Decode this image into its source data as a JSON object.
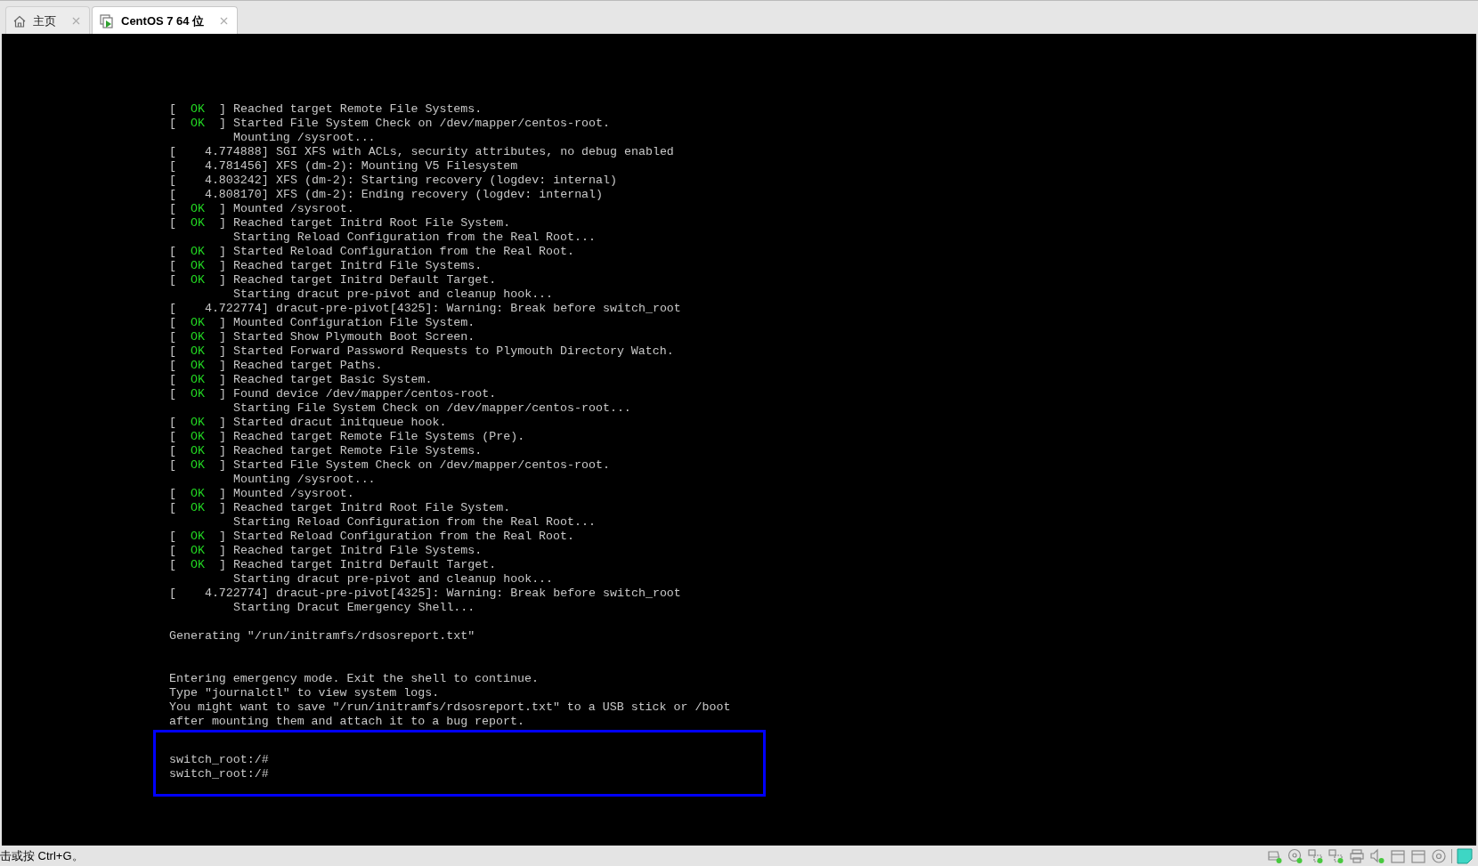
{
  "tabs": [
    {
      "kind": "home",
      "label": "主页",
      "selected": false
    },
    {
      "kind": "vm",
      "label": "CentOS 7 64 位",
      "selected": true
    }
  ],
  "console": {
    "lines": [
      {
        "kind": "ok",
        "open": "[",
        "status": "OK",
        "close": "]",
        "text": "Reached target Remote File Systems."
      },
      {
        "kind": "ok",
        "open": "[",
        "status": "OK",
        "close": "]",
        "text": "Started File System Check on /dev/mapper/centos-root."
      },
      {
        "kind": "job",
        "text": "Mounting /sysroot..."
      },
      {
        "kind": "kernel",
        "time": "[    4.774888]",
        "text": "SGI XFS with ACLs, security attributes, no debug enabled"
      },
      {
        "kind": "kernel",
        "time": "[    4.781456]",
        "text": "XFS (dm-2): Mounting V5 Filesystem"
      },
      {
        "kind": "kernel",
        "time": "[    4.803242]",
        "text": "XFS (dm-2): Starting recovery (logdev: internal)"
      },
      {
        "kind": "kernel",
        "time": "[    4.808170]",
        "text": "XFS (dm-2): Ending recovery (logdev: internal)"
      },
      {
        "kind": "ok",
        "open": "[",
        "status": "OK",
        "close": "]",
        "text": "Mounted /sysroot."
      },
      {
        "kind": "ok",
        "open": "[",
        "status": "OK",
        "close": "]",
        "text": "Reached target Initrd Root File System."
      },
      {
        "kind": "job",
        "text": "Starting Reload Configuration from the Real Root..."
      },
      {
        "kind": "ok",
        "open": "[",
        "status": "OK",
        "close": "]",
        "text": "Started Reload Configuration from the Real Root."
      },
      {
        "kind": "ok",
        "open": "[",
        "status": "OK",
        "close": "]",
        "text": "Reached target Initrd File Systems."
      },
      {
        "kind": "ok",
        "open": "[",
        "status": "OK",
        "close": "]",
        "text": "Reached target Initrd Default Target."
      },
      {
        "kind": "job",
        "text": "Starting dracut pre-pivot and cleanup hook..."
      },
      {
        "kind": "kernel",
        "time": "[    4.722774]",
        "text": "dracut-pre-pivot[4325]: Warning: Break before switch_root"
      },
      {
        "kind": "ok",
        "open": "[",
        "status": "OK",
        "close": "]",
        "text": "Mounted Configuration File System."
      },
      {
        "kind": "ok",
        "open": "[",
        "status": "OK",
        "close": "]",
        "text": "Started Show Plymouth Boot Screen."
      },
      {
        "kind": "ok",
        "open": "[",
        "status": "OK",
        "close": "]",
        "text": "Started Forward Password Requests to Plymouth Directory Watch."
      },
      {
        "kind": "ok",
        "open": "[",
        "status": "OK",
        "close": "]",
        "text": "Reached target Paths."
      },
      {
        "kind": "ok",
        "open": "[",
        "status": "OK",
        "close": "]",
        "text": "Reached target Basic System."
      },
      {
        "kind": "ok",
        "open": "[",
        "status": "OK",
        "close": "]",
        "text": "Found device /dev/mapper/centos-root."
      },
      {
        "kind": "job",
        "text": "Starting File System Check on /dev/mapper/centos-root..."
      },
      {
        "kind": "ok",
        "open": "[",
        "status": "OK",
        "close": "]",
        "text": "Started dracut initqueue hook."
      },
      {
        "kind": "ok",
        "open": "[",
        "status": "OK",
        "close": "]",
        "text": "Reached target Remote File Systems (Pre)."
      },
      {
        "kind": "ok",
        "open": "[",
        "status": "OK",
        "close": "]",
        "text": "Reached target Remote File Systems."
      },
      {
        "kind": "ok",
        "open": "[",
        "status": "OK",
        "close": "]",
        "text": "Started File System Check on /dev/mapper/centos-root."
      },
      {
        "kind": "job",
        "text": "Mounting /sysroot..."
      },
      {
        "kind": "ok",
        "open": "[",
        "status": "OK",
        "close": "]",
        "text": "Mounted /sysroot."
      },
      {
        "kind": "ok",
        "open": "[",
        "status": "OK",
        "close": "]",
        "text": "Reached target Initrd Root File System."
      },
      {
        "kind": "job",
        "text": "Starting Reload Configuration from the Real Root..."
      },
      {
        "kind": "ok",
        "open": "[",
        "status": "OK",
        "close": "]",
        "text": "Started Reload Configuration from the Real Root."
      },
      {
        "kind": "ok",
        "open": "[",
        "status": "OK",
        "close": "]",
        "text": "Reached target Initrd File Systems."
      },
      {
        "kind": "ok",
        "open": "[",
        "status": "OK",
        "close": "]",
        "text": "Reached target Initrd Default Target."
      },
      {
        "kind": "job",
        "text": "Starting dracut pre-pivot and cleanup hook..."
      },
      {
        "kind": "kernel",
        "time": "[    4.722774]",
        "text": "dracut-pre-pivot[4325]: Warning: Break before switch_root"
      },
      {
        "kind": "job",
        "text": "Starting Dracut Emergency Shell..."
      },
      {
        "kind": "blank"
      },
      {
        "kind": "plain",
        "text": "Generating \"/run/initramfs/rdsosreport.txt\""
      },
      {
        "kind": "blank"
      },
      {
        "kind": "blank"
      },
      {
        "kind": "plain",
        "text": "Entering emergency mode. Exit the shell to continue."
      },
      {
        "kind": "plain",
        "text": "Type \"journalctl\" to view system logs."
      },
      {
        "kind": "plain",
        "text": "You might want to save \"/run/initramfs/rdsosreport.txt\" to a USB stick or /boot"
      },
      {
        "kind": "plain",
        "text": "after mounting them and attach it to a bug report."
      }
    ],
    "highlighted_prompts": [
      "switch_root:/#",
      "switch_root:/#"
    ]
  },
  "status_bar": {
    "hint": "击或按 Ctrl+G。"
  }
}
